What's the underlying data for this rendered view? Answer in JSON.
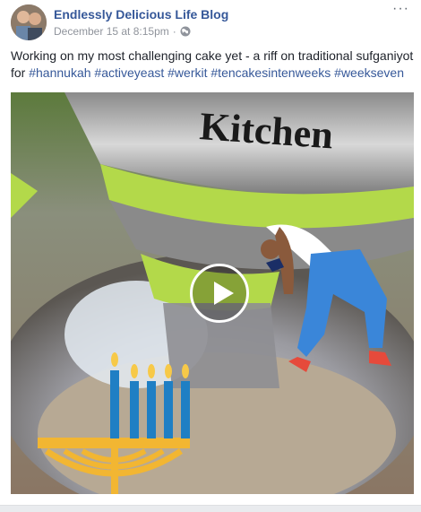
{
  "post": {
    "author": "Endlessly Delicious Life Blog",
    "date": "December 15 at 8:15pm",
    "separator": "·",
    "privacy_icon": "globe-icon",
    "options_icon": "more-options-icon",
    "options_label": "···",
    "text": "Working on my most challenging cake yet - a riff on traditional sufganiyot for ",
    "hashtags": [
      "#hannukah",
      "#activeyeast",
      "#werkit",
      "#tencakesintenweeks",
      "#weekseven"
    ]
  },
  "video": {
    "mixer_brand": "Kitchen",
    "play_icon": "play-icon",
    "sticker_left": "menorah-sticker",
    "sticker_right": "dancing-person-sticker"
  },
  "colors": {
    "link": "#365899",
    "text": "#1d2129",
    "meta": "#90949c",
    "mixer_green": "#b3d94a",
    "menorah_blue": "#1f7fc4",
    "menorah_gold": "#f2b632"
  }
}
